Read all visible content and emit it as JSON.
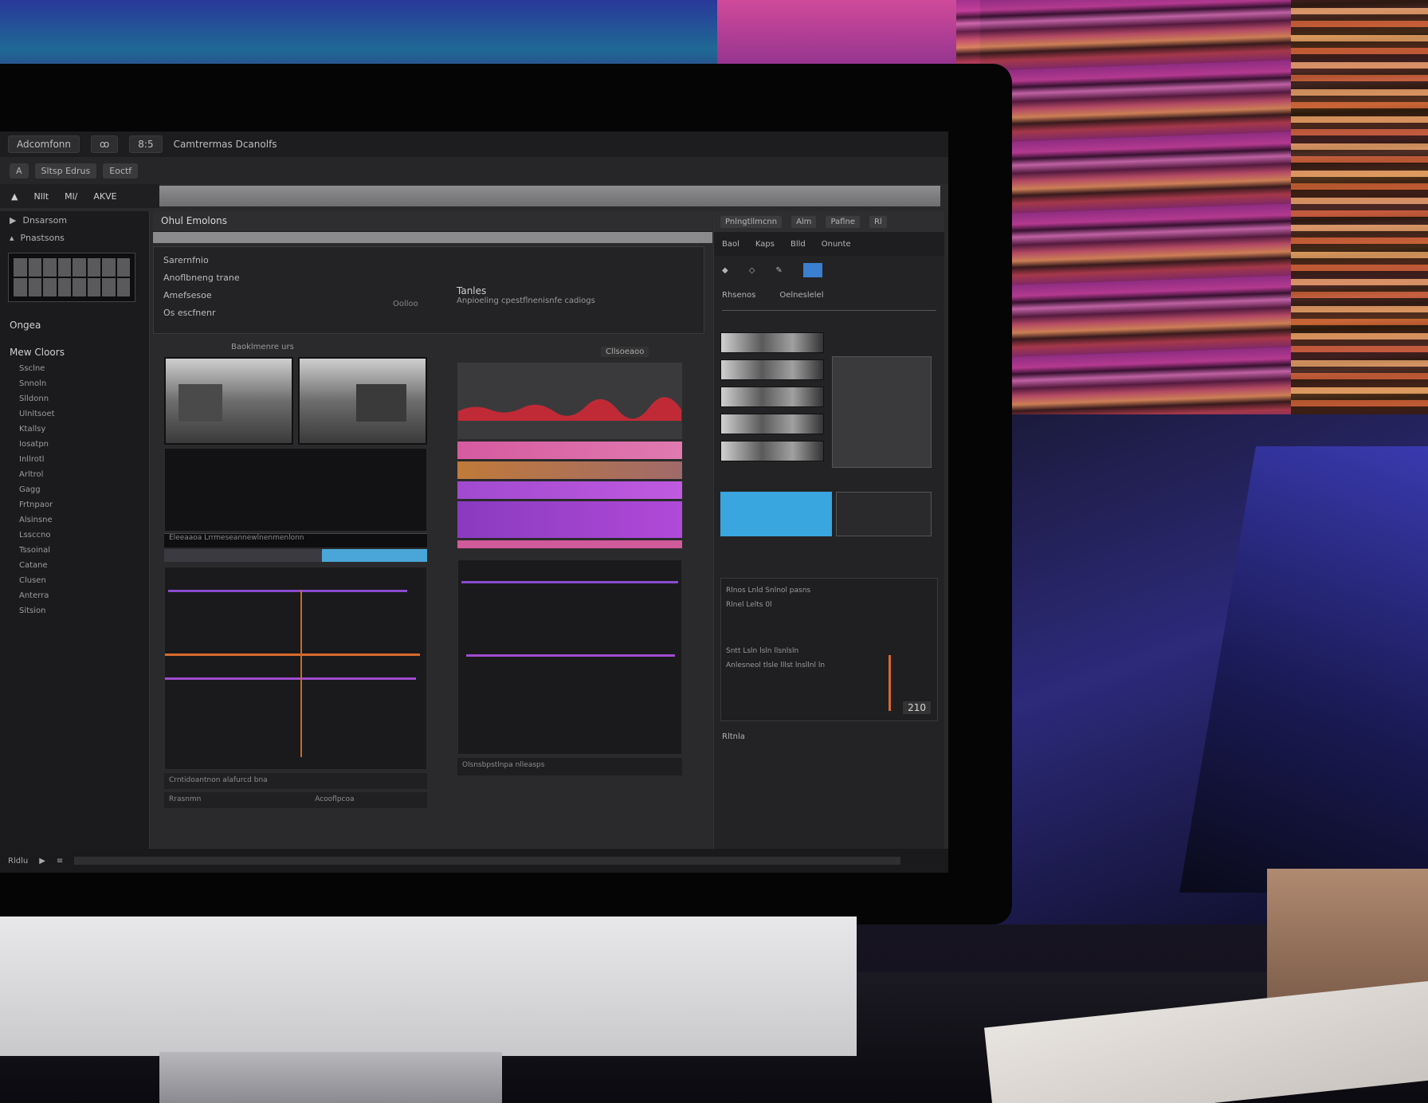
{
  "menubar": {
    "app_name": "Adcomfonn",
    "tab_a": "ꝏ",
    "tab_b": "8:5",
    "breadcrumb": "Camtrermas Dcanolfs"
  },
  "toolbar": {
    "chip_a": "A",
    "chip_b": "Sltsp Edrus",
    "chip_c": "Eoctf"
  },
  "modebar": {
    "m1": "Nllt",
    "m2": "Ml/",
    "m3": "AKVE"
  },
  "left_panel": {
    "items": [
      "Dnsarsom",
      "Pnastsons"
    ],
    "section_title": "Ongea",
    "subsection": "Mew Cloors",
    "list": [
      "Ssclne",
      "Snnoln",
      "Slldonn",
      "Ulnltsoet",
      "Ktallsy",
      "Iosatpn",
      "Inllrotl",
      "Arltrol",
      "Gagg",
      "Frtnpaor",
      "Alsinsne",
      "Lssccno",
      "Tssoinal",
      "Catane",
      "Clusen",
      "Anterra",
      "Sitsion"
    ]
  },
  "center": {
    "header": "Ohul Emolons",
    "info": {
      "line1": "Sarernfnio",
      "line2": "Anoflbneng trane",
      "line3": "Amefsesoe",
      "line4": "Os escfnenr",
      "hint": "Oolloo",
      "right_title": "Tanles",
      "right_sub": "Anpioeling cpestflnenisnfe cadiogs"
    },
    "video_caption": "Baoklmenre urs",
    "bar_strip": "Eleeaaoa Lrrmeseannewlnenmenlonn",
    "graph_footer": "Crntidoantnon alafurcd bna",
    "footer_btn": "Rrasnmn",
    "footer_right": "Acooflpcoa"
  },
  "audio": {
    "top_label": "Cllsoeaoo",
    "footer": "Olsnsbpstlnpa nlleasps"
  },
  "right_panel": {
    "head_chips": [
      "Pnlngtllmcnn",
      "Alm",
      "Paflne",
      "Rl"
    ],
    "head_label": "Onunte",
    "tabs": [
      "Baol",
      "Kaps",
      "Blld"
    ],
    "props_a": "Rhsenos",
    "props_b": "Oelneslelel",
    "meta": [
      "Rlnos Lnld Snlnol pasns",
      "Rlnel Lelts 0l",
      "Sntt Lsln lsln llsnlsln",
      "Anlesneol tlsle lllst lnsllnl ln"
    ],
    "timecode": "210",
    "bottom_label": "Rltnla"
  },
  "statusbar": {
    "label": "Rldlu",
    "icons": [
      "▶",
      "≡"
    ]
  },
  "colors": {
    "accent_blue": "#3aa6e0",
    "waveform_red": "#d0303a",
    "track_purple": "#a04ad0",
    "track_orange": "#d86a2a"
  }
}
